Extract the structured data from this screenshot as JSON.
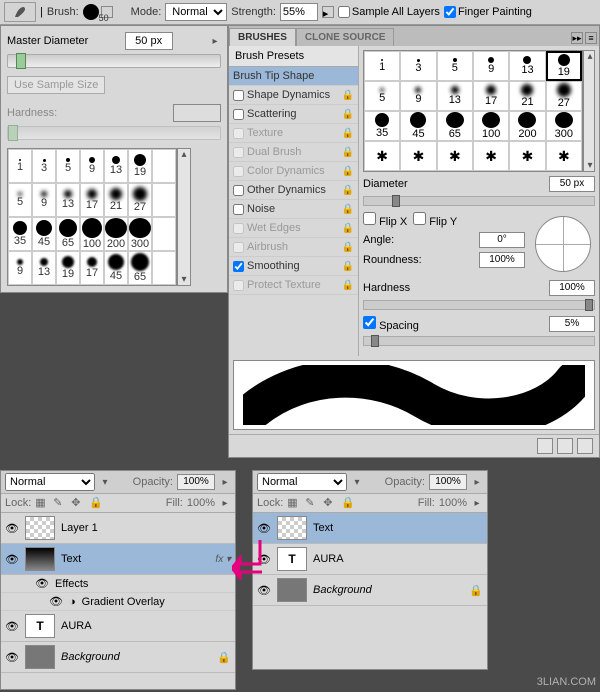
{
  "toolbar": {
    "brush_label": "Brush:",
    "brush_size": "50",
    "mode_label": "Mode:",
    "mode_value": "Normal",
    "strength_label": "Strength:",
    "strength_value": "55%",
    "sample_all": "Sample All Layers",
    "finger_paint": "Finger Painting"
  },
  "picker": {
    "master_label": "Master Diameter",
    "master_value": "50 px",
    "use_sample": "Use Sample Size",
    "hardness_label": "Hardness:",
    "sizes_row1": [
      "1",
      "3",
      "5",
      "9",
      "13",
      "19"
    ],
    "sizes_row2": [
      "5",
      "9",
      "13",
      "17",
      "21",
      "27"
    ],
    "sizes_row3": [
      "35",
      "45",
      "65",
      "100",
      "200",
      "300"
    ],
    "sizes_row4": [
      "9",
      "13",
      "19",
      "17",
      "45",
      "65"
    ]
  },
  "brushes": {
    "tab1": "BRUSHES",
    "tab2": "CLONE SOURCE",
    "presets": "Brush Presets",
    "tip_shape": "Brush Tip Shape",
    "opts": [
      {
        "label": "Shape Dynamics",
        "checked": false,
        "enabled": true,
        "lock": true
      },
      {
        "label": "Scattering",
        "checked": false,
        "enabled": true,
        "lock": true
      },
      {
        "label": "Texture",
        "checked": false,
        "enabled": false,
        "lock": true
      },
      {
        "label": "Dual Brush",
        "checked": false,
        "enabled": false,
        "lock": true
      },
      {
        "label": "Color Dynamics",
        "checked": false,
        "enabled": false,
        "lock": true
      },
      {
        "label": "Other Dynamics",
        "checked": false,
        "enabled": true,
        "lock": true
      },
      {
        "label": "Noise",
        "checked": false,
        "enabled": true,
        "lock": true
      },
      {
        "label": "Wet Edges",
        "checked": false,
        "enabled": false,
        "lock": true
      },
      {
        "label": "Airbrush",
        "checked": false,
        "enabled": false,
        "lock": true
      },
      {
        "label": "Smoothing",
        "checked": true,
        "enabled": true,
        "lock": true
      },
      {
        "label": "Protect Texture",
        "checked": false,
        "enabled": false,
        "lock": true
      }
    ],
    "grid_row1": [
      "1",
      "3",
      "5",
      "9",
      "13",
      "19"
    ],
    "grid_row2": [
      "5",
      "9",
      "13",
      "17",
      "21",
      "27"
    ],
    "grid_row3": [
      "35",
      "45",
      "65",
      "100",
      "200",
      "300"
    ],
    "diameter_label": "Diameter",
    "diameter_value": "50 px",
    "flipx": "Flip X",
    "flipy": "Flip Y",
    "angle_label": "Angle:",
    "angle_value": "0°",
    "roundness_label": "Roundness:",
    "roundness_value": "100%",
    "hardness_label": "Hardness",
    "hardness_value": "100%",
    "spacing_label": "Spacing",
    "spacing_value": "5%"
  },
  "layers_left": {
    "blend": "Normal",
    "opacity_label": "Opacity:",
    "opacity_value": "100%",
    "lock_label": "Lock:",
    "fill_label": "Fill:",
    "fill_value": "100%",
    "rows": [
      {
        "name": "Layer 1",
        "type": "checker"
      },
      {
        "name": "Text",
        "type": "grad",
        "fx": "fx ▾",
        "sel": true
      },
      {
        "name": "Effects",
        "type": "sub"
      },
      {
        "name": "Gradient Overlay",
        "type": "sub2"
      },
      {
        "name": "AURA",
        "type": "T"
      },
      {
        "name": "Background",
        "type": "grey",
        "lock": true
      }
    ]
  },
  "layers_right": {
    "blend": "Normal",
    "opacity_label": "Opacity:",
    "opacity_value": "100%",
    "lock_label": "Lock:",
    "fill_label": "Fill:",
    "fill_value": "100%",
    "rows": [
      {
        "name": "Text",
        "type": "checker",
        "sel": true
      },
      {
        "name": "AURA",
        "type": "T"
      },
      {
        "name": "Background",
        "type": "grey",
        "lock": true
      }
    ]
  },
  "watermark": "3LIAN.COM"
}
